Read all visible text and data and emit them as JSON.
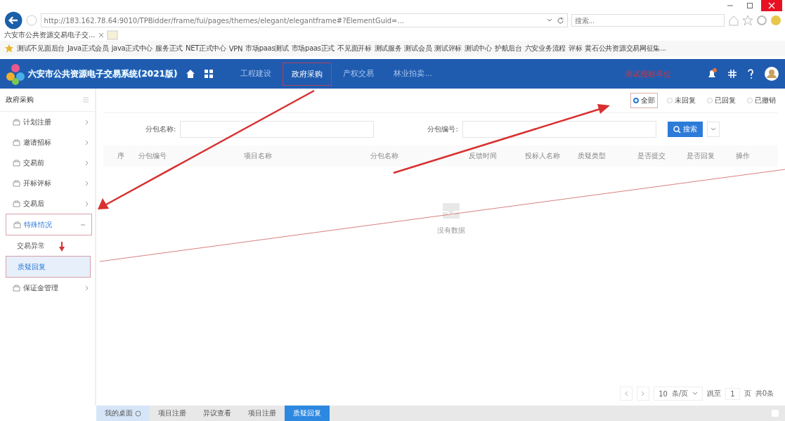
{
  "browser": {
    "address": "http://183.162.78.64:9010/TPBidder/frame/fui/pages/themes/elegant/elegantframe#?ElementGuid=...",
    "search_placeholder": "搜索...",
    "tab_title": "六安市公共资源交易电子交...",
    "bookmarks": [
      "测试不见面后台",
      "Java正式会员",
      "java正式中心",
      "服务正式",
      "NET正式中心",
      "VPN",
      "市场paas测试",
      "市场paas正式",
      "不见面开标",
      "测试服务",
      "测试会员",
      "测试评标",
      "测试中心",
      "护航后台",
      "六安业务流程",
      "评标",
      "黄石公共资源交易网征集..."
    ]
  },
  "header": {
    "logo_text": "六安市公共资源电子交易系统(2021版)",
    "nav": [
      {
        "label": "工程建设",
        "selected": false
      },
      {
        "label": "政府采购",
        "selected": true
      },
      {
        "label": "产权交易",
        "selected": false
      },
      {
        "label": "林业拍卖...",
        "selected": false
      }
    ],
    "user": "测试投标单位"
  },
  "sidebar": {
    "title": "政府采购",
    "items": [
      {
        "label": "计划注册",
        "expanded": false,
        "selected": false
      },
      {
        "label": "邀请招标",
        "expanded": false,
        "selected": false
      },
      {
        "label": "交易前",
        "expanded": false,
        "selected": false
      },
      {
        "label": "开标评标",
        "expanded": false,
        "selected": false
      },
      {
        "label": "交易后",
        "expanded": false,
        "selected": false
      },
      {
        "label": "特殊情况",
        "expanded": true,
        "selected": true,
        "children": [
          {
            "label": "交易异常",
            "selected": false
          },
          {
            "label": "质疑回复",
            "selected": true
          }
        ]
      },
      {
        "label": "保证金管理",
        "expanded": false,
        "selected": false
      }
    ]
  },
  "filter": {
    "radios": [
      {
        "label": "全部",
        "selected": true
      },
      {
        "label": "未回复",
        "selected": false
      },
      {
        "label": "已回复",
        "selected": false
      },
      {
        "label": "已撤销",
        "selected": false
      }
    ],
    "fields": [
      {
        "label": "分包名称:"
      },
      {
        "label": "分包编号:"
      }
    ],
    "search_button": "搜索"
  },
  "table": {
    "columns": [
      "序",
      "分包编号",
      "项目名称",
      "分包名称",
      "反馈时间",
      "投标人名称",
      "质疑类型",
      "是否提交",
      "是否回复",
      "操作"
    ],
    "empty_text": "没有数据"
  },
  "pagination": {
    "page_size": "10",
    "per_page": "条/页",
    "jump_label": "跳至",
    "page": "1",
    "page_unit": "页",
    "total": "共0条"
  },
  "bottom_tabs": [
    {
      "label": "我的桌面",
      "selected": false
    },
    {
      "label": "项目注册",
      "selected": false
    },
    {
      "label": "异议查看",
      "selected": false
    },
    {
      "label": "项目注册",
      "selected": false
    },
    {
      "label": "质疑回复",
      "selected": true
    }
  ]
}
